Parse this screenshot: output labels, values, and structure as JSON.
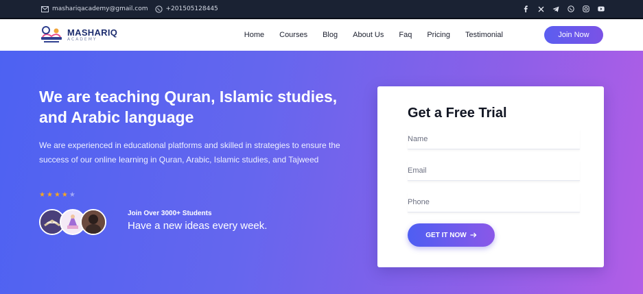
{
  "topbar": {
    "email": "mashariqacademy@gmail.com",
    "phone": "+201505128445",
    "socials": [
      "facebook-icon",
      "x-icon",
      "telegram-icon",
      "whatsapp-icon",
      "instagram-icon",
      "youtube-icon"
    ]
  },
  "header": {
    "logo_name": "MASHARIQ",
    "logo_sub": "ACADEMY",
    "nav": [
      "Home",
      "Courses",
      "Blog",
      "About Us",
      "Faq",
      "Pricing",
      "Testimonial"
    ],
    "cta": "Join Now"
  },
  "hero": {
    "title": "We are teaching Quran, Islamic studies, and Arabic language",
    "description": "We are experienced in educational platforms and skilled in strategies to ensure the success of our online learning in Quran, Arabic, Islamic studies, and Tajweed",
    "rating": 4,
    "rating_max": 5,
    "join_label": "Join Over 3000+ Students",
    "tagline": "Have a new ideas every week."
  },
  "form": {
    "title": "Get a Free Trial",
    "name_placeholder": "Name",
    "email_placeholder": "Email",
    "phone_placeholder": "Phone",
    "submit_label": "GET IT NOW"
  },
  "colors": {
    "accent": "#5b5ef0",
    "topbar": "#1a2233",
    "star": "#f5a623"
  }
}
